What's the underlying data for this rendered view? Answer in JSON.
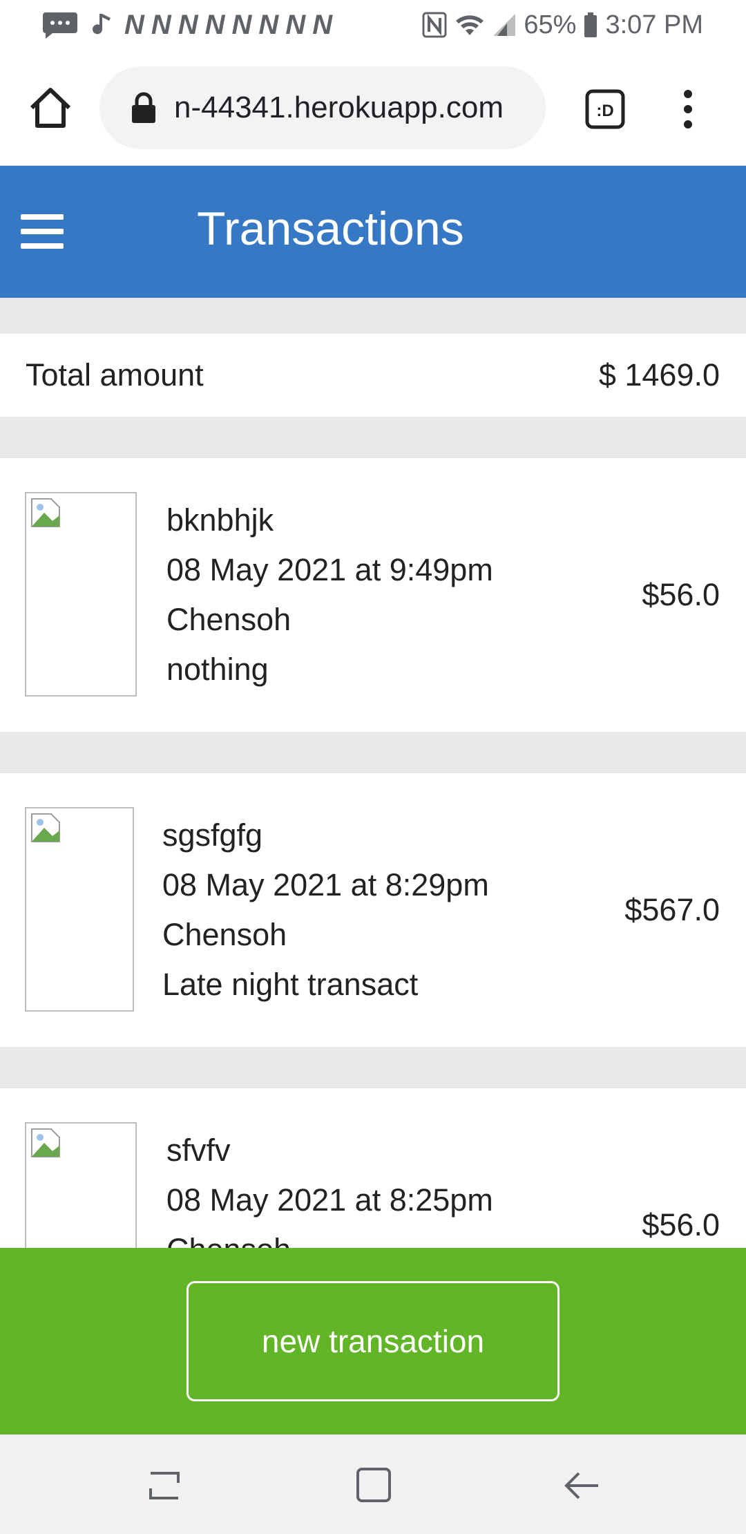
{
  "status_bar": {
    "n_icons": "NNNNNNNN",
    "battery": "65%",
    "time": "3:07 PM"
  },
  "browser": {
    "url": "n-44341.herokuapp.com"
  },
  "header": {
    "title": "Transactions"
  },
  "total": {
    "label": "Total amount",
    "value": "$ 1469.0"
  },
  "transactions": [
    {
      "title": "bknbhjk",
      "date": "08 May 2021 at 9:49pm",
      "user": "Chensoh",
      "note": "nothing",
      "amount": "$56.0"
    },
    {
      "title": "sgsfgfg",
      "date": "08 May 2021 at 8:29pm",
      "user": "Chensoh",
      "note": "Late night transact",
      "amount": "$567.0"
    },
    {
      "title": "sfvfv",
      "date": "08 May 2021 at 8:25pm",
      "user": "Chensoh",
      "note": "",
      "amount": "$56.0"
    }
  ],
  "action": {
    "new_transaction_label": "new transaction"
  },
  "colors": {
    "header_blue": "#3678c4",
    "action_green": "#62b526"
  }
}
